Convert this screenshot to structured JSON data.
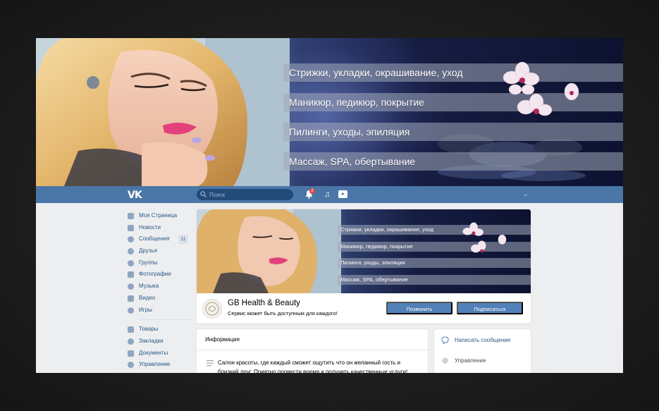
{
  "cover": {
    "services": [
      "Стрижки, укладки, окрашивание, уход",
      "Маникюр, педикюр, покрытие",
      "Пилинги, уходы, эпиляция",
      "Массаж, SPA, обертывание"
    ]
  },
  "header": {
    "search_placeholder": "Поиск",
    "notifications_count": "2"
  },
  "nav": {
    "items": [
      {
        "label": "Моя Страница"
      },
      {
        "label": "Новости"
      },
      {
        "label": "Сообщения",
        "count": "11"
      },
      {
        "label": "Друзья"
      },
      {
        "label": "Группы"
      },
      {
        "label": "Фотографии"
      },
      {
        "label": "Музыка"
      },
      {
        "label": "Видео"
      },
      {
        "label": "Игры"
      }
    ],
    "secondary": [
      {
        "label": "Товары"
      },
      {
        "label": "Закладки"
      },
      {
        "label": "Документы"
      },
      {
        "label": "Управление"
      }
    ]
  },
  "group": {
    "name": "GB Health & Beauty",
    "status": "Сервис может быть доступным для каждого!",
    "call_button": "Позвонить",
    "subscribe_button": "Подписаться"
  },
  "info": {
    "title": "Информация",
    "description": "Салон красоты, где каждый сможет ощутить что он желанный гость и близкий друг. Приятно провести время и получить качественные услуги!"
  },
  "actions": {
    "write_message": "Написать сообщение",
    "manage": "Управление"
  },
  "colors": {
    "vk_blue": "#4a76a8",
    "button_blue": "#5181b8",
    "link": "#2a5885",
    "page_bg": "#edeef0"
  }
}
